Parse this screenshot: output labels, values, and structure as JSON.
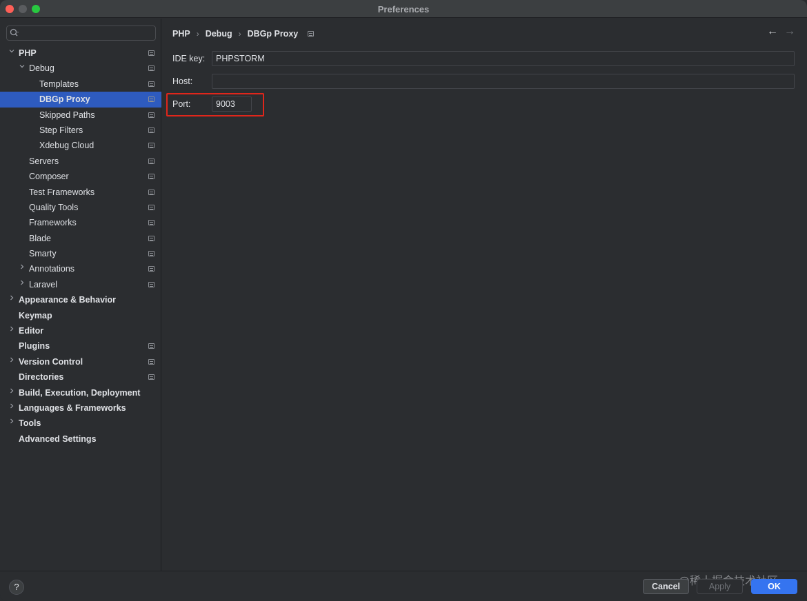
{
  "window": {
    "title": "Preferences"
  },
  "search": {
    "placeholder": ""
  },
  "sidebar": {
    "items": [
      {
        "label": "PHP",
        "level": 0,
        "expandable": true,
        "expanded": true,
        "bold": true,
        "project": true,
        "selected": false
      },
      {
        "label": "Debug",
        "level": 1,
        "expandable": true,
        "expanded": true,
        "bold": false,
        "project": true,
        "selected": false
      },
      {
        "label": "Templates",
        "level": 2,
        "expandable": false,
        "bold": false,
        "project": true,
        "selected": false
      },
      {
        "label": "DBGp Proxy",
        "level": 2,
        "expandable": false,
        "bold": true,
        "project": true,
        "selected": true
      },
      {
        "label": "Skipped Paths",
        "level": 2,
        "expandable": false,
        "bold": false,
        "project": true,
        "selected": false
      },
      {
        "label": "Step Filters",
        "level": 2,
        "expandable": false,
        "bold": false,
        "project": true,
        "selected": false
      },
      {
        "label": "Xdebug Cloud",
        "level": 2,
        "expandable": false,
        "bold": false,
        "project": true,
        "selected": false
      },
      {
        "label": "Servers",
        "level": 1,
        "expandable": false,
        "bold": false,
        "project": true,
        "selected": false
      },
      {
        "label": "Composer",
        "level": 1,
        "expandable": false,
        "bold": false,
        "project": true,
        "selected": false
      },
      {
        "label": "Test Frameworks",
        "level": 1,
        "expandable": false,
        "bold": false,
        "project": true,
        "selected": false
      },
      {
        "label": "Quality Tools",
        "level": 1,
        "expandable": false,
        "bold": false,
        "project": true,
        "selected": false
      },
      {
        "label": "Frameworks",
        "level": 1,
        "expandable": false,
        "bold": false,
        "project": true,
        "selected": false
      },
      {
        "label": "Blade",
        "level": 1,
        "expandable": false,
        "bold": false,
        "project": true,
        "selected": false
      },
      {
        "label": "Smarty",
        "level": 1,
        "expandable": false,
        "bold": false,
        "project": true,
        "selected": false
      },
      {
        "label": "Annotations",
        "level": 1,
        "expandable": true,
        "expanded": false,
        "bold": false,
        "project": true,
        "selected": false
      },
      {
        "label": "Laravel",
        "level": 1,
        "expandable": true,
        "expanded": false,
        "bold": false,
        "project": true,
        "selected": false
      },
      {
        "label": "Appearance & Behavior",
        "level": 0,
        "expandable": true,
        "expanded": false,
        "bold": true,
        "project": false,
        "selected": false
      },
      {
        "label": "Keymap",
        "level": 0,
        "expandable": false,
        "bold": true,
        "project": false,
        "selected": false
      },
      {
        "label": "Editor",
        "level": 0,
        "expandable": true,
        "expanded": false,
        "bold": true,
        "project": false,
        "selected": false
      },
      {
        "label": "Plugins",
        "level": 0,
        "expandable": false,
        "bold": true,
        "project": true,
        "selected": false
      },
      {
        "label": "Version Control",
        "level": 0,
        "expandable": true,
        "expanded": false,
        "bold": true,
        "project": true,
        "selected": false
      },
      {
        "label": "Directories",
        "level": 0,
        "expandable": false,
        "bold": true,
        "project": true,
        "selected": false
      },
      {
        "label": "Build, Execution, Deployment",
        "level": 0,
        "expandable": true,
        "expanded": false,
        "bold": true,
        "project": false,
        "selected": false
      },
      {
        "label": "Languages & Frameworks",
        "level": 0,
        "expandable": true,
        "expanded": false,
        "bold": true,
        "project": false,
        "selected": false
      },
      {
        "label": "Tools",
        "level": 0,
        "expandable": true,
        "expanded": false,
        "bold": true,
        "project": false,
        "selected": false
      },
      {
        "label": "Advanced Settings",
        "level": 0,
        "expandable": false,
        "bold": true,
        "project": false,
        "selected": false
      }
    ]
  },
  "breadcrumb": {
    "items": [
      "PHP",
      "Debug",
      "DBGp Proxy"
    ],
    "separator": "›"
  },
  "nav": {
    "back_icon": "arrow-left-icon",
    "forward_icon": "arrow-right-icon"
  },
  "form": {
    "ide_key_label": "IDE key:",
    "ide_key_value": "PHPSTORM",
    "host_label": "Host:",
    "host_value": "",
    "port_label": "Port:",
    "port_value": "9003"
  },
  "footer": {
    "help_label": "?",
    "cancel_label": "Cancel",
    "apply_label": "Apply",
    "ok_label": "OK",
    "watermark": "@稀土掘金技术社区"
  },
  "colors": {
    "background": "#2b2d30",
    "selection": "#2e5bbf",
    "accent": "#3574f0",
    "highlight_border": "#e0261b"
  }
}
